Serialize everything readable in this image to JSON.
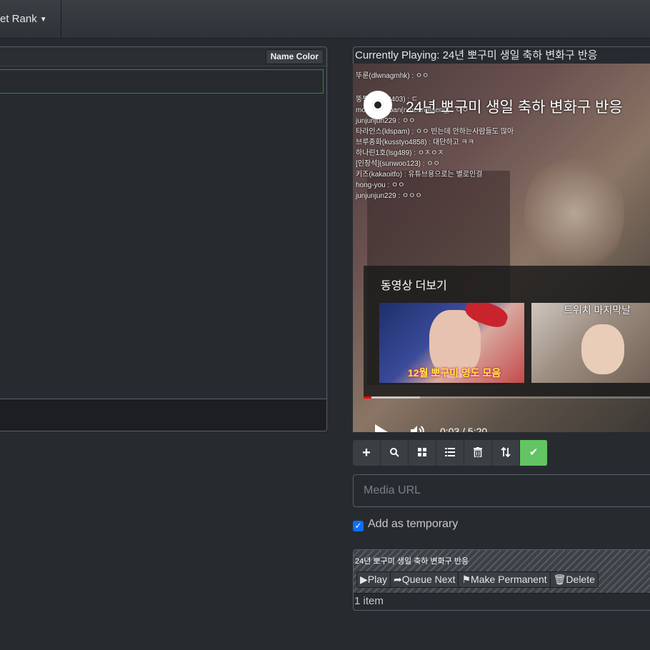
{
  "navbar": {
    "rank_label": "et Rank"
  },
  "chat": {
    "name_color_label": "Name Color"
  },
  "player": {
    "now_playing_prefix": "Currently Playing:",
    "now_playing_title": "24년 뽀구미 생일 축하 변화구 반응",
    "video_title": "24년 뽀구미 생일 축하 변화구 반응",
    "more_videos_label": "동영상 더보기",
    "thumb1_caption": "12월 뽀구미 영도 모음",
    "thumb2_caption": "트위치 마지막날",
    "time": "0:03 / 5:20",
    "progress_played": 0.027,
    "progress_buffered": 0.19,
    "overlay_chat": [
      "뚜룬(dlwnagmhk) : ㅇㅇ",
      "뚱짱(hd870403) : ㄷ",
      "moneyno_ban(nmeongtaeng) : ㅇㅇ",
      "junjunjun229 : ㅇㅇ",
      "타라인스(ldspam) : ㅇㅇ 빈는데 안하는사람들도 많아",
      "브루종화(kusstyo4858) : 대단하고 ㅋㅋ",
      "하나린1호(lsg489) : ㅇㅈㅇㅈ",
      "[인장석](sunwoo123) : ㅇㅇ",
      "키즈(kakaoitfo) : 유튜브용으로는 별로인걸",
      "hong-you : ㅇㅇ",
      "junjunjun229 : ㅇㅇㅇ"
    ]
  },
  "toolbar": {
    "icons": [
      "plus-icon",
      "search-icon",
      "grid-icon",
      "list-icon",
      "trash-icon",
      "sort-icon",
      "check-icon"
    ]
  },
  "media_url": {
    "placeholder": "Media URL"
  },
  "temporary": {
    "label": "Add as temporary",
    "checked": true
  },
  "queue": {
    "items": [
      {
        "title": "24년 뽀구미 생일 축하 변화구 반응",
        "play_label": "Play",
        "queue_next_label": "Queue Next",
        "permanent_label": "Make Permanent",
        "delete_label": "Delete"
      }
    ],
    "count_label": "1 item"
  }
}
